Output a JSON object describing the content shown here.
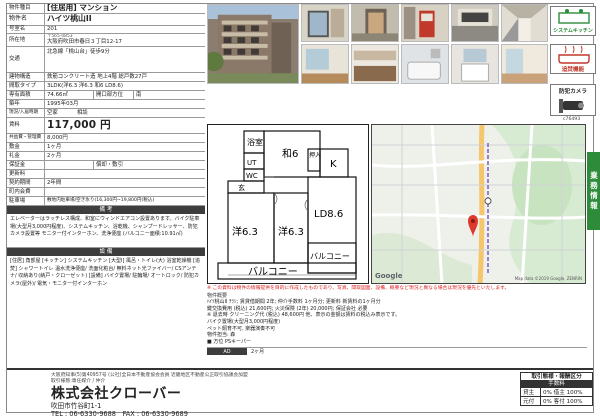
{
  "property": {
    "category_label": "物件種目",
    "category": "[住居用] マンション",
    "name_label": "物件名",
    "name": "ハイツ桃山II",
    "room_label": "号室名",
    "room": "201",
    "address_label": "所在地",
    "postal": "〒565-0853",
    "address": "大阪府吹田市春日３丁目12-17",
    "transport_label": "交通",
    "transport": "北急線「桃山台」徒歩9分",
    "structure_label": "建物構造",
    "structure": "鉄筋コンクリート造 地上4階 総戸数27戸",
    "layout_label": "間取タイプ",
    "layout": "3LDK(洋6.3 洋6.3 和6 LD8.6)",
    "area_label": "専有面積",
    "area": "74.66㎡",
    "direction_label": "開口部方位",
    "direction": "南",
    "built_label": "築年",
    "built": "1995年03月",
    "status_label": "現況/入居時期",
    "status_a": "空家",
    "status_b": "相談",
    "rent_label": "賃料",
    "rent": "117,000 円",
    "fee_label": "共益費・管理費",
    "fee": "8,000円",
    "deposit_label": "敷金",
    "deposit": "1ヶ月",
    "key_label": "礼金",
    "key": "2ヶ月",
    "guarantee_label": "保証金",
    "guarantee_a": "償却・敷引",
    "renewal_label": "更新料",
    "term_label": "契約期間",
    "term": "2年間",
    "assoc_label": "町内会費",
    "parking_label": "駐車場",
    "parking": "敷地内駐車場/空き氷り(16,300円~19,800円(税込)"
  },
  "remarks": {
    "header": "備 考",
    "text": "エレベーターはラッチレス構成、和室にウィンドエアコン設置あります。バイク駐車場(大型月3,000円程度)、システムキッチン、浴乾機、シャンプードレッサー、防犯カメラ設置等 モニター付インターホン、洗浄便座 (バルコニー面積:10.91㎡)"
  },
  "equipment": {
    "header": "設 備",
    "text": "[住居] 角部屋 [キッチン] システムキッチン [大型I] 風呂・トイレ(大) 浴室乾燥機 [追焚] シャワートイレ 温水洗浄便座/ 洗面化粧台/ 無料ネット光ファイバー/ CSアンテナ/ 収納あり(納戸・クローゼット) [設備] バイク置場/ 駐輪場/ オートロック/ 防犯カメラ(屋外)/ 電気・モニター付インターホン"
  },
  "badges": {
    "system_kitchen": "システムキッチン",
    "shower_toilet": "追焚機能",
    "security_camera": "防犯カメラ",
    "code": "c76493"
  },
  "side_tab": [
    "業",
    "務",
    "情",
    "報"
  ],
  "plan": {
    "bath": "浴室",
    "ut": "UT",
    "wa": "和6",
    "k": "K",
    "wc": "WC",
    "shu": "押入",
    "hall": "玄",
    "ld": "LD8.6",
    "west": "洋6.3",
    "east": "洋6.3",
    "balcony": "バルコニー",
    "balcony2": "バルコニー"
  },
  "map": {
    "google": "Google",
    "copyright": "Map data ©2019 Google, ZENRIN"
  },
  "notice": {
    "red": "※ この資料は物件の情報提供を目的に作成したものであり、写真、間取図面、設備、概要など現況と異なる場合は現況を優先といたします。",
    "caption": "物件概要",
    "lines": [
      "ﾊｲﾂ桃山II ﾁﾗｼ; 賃貸借期間 2年; 仲介手数料 1ヶ月分; 更新料 新賃料の1ヶ月分",
      "鍵交換費用 (税込) 21,600円; 火災保険 (2年) 20,000円; 保証会社 必要",
      "※ 退去時 クリーニング代 (税込) 48,600円 他、表示の金額は賃料の税込み表示です。",
      "バイク置場(大型月3,000円程度)",
      "ペット飼育不可, 楽器演奏不可",
      "物件担当: 森",
      "■ 方位 PSキーパー"
    ],
    "ad_label": "AD",
    "ad_value": "2ヶ月"
  },
  "company": {
    "address_line": "大阪府知事(5)第40957号 (公社)全日本不動産協会会員 近畿地区不動産公正取引協議会加盟",
    "license_line": "取引様態:専任媒介 / 仲介",
    "name": "株式会社クローバー",
    "street": "吹田市竹谷町1-1",
    "tel": "TEL : 06-6330-9688　FAX : 06-6330-9689"
  },
  "fees": {
    "title": "取引態様・報酬区分",
    "head": "手数料",
    "row1_k": "貸主",
    "row1_v": "0% 借主 100%",
    "row2_k": "元付",
    "row2_v": "0% 客付 100%"
  },
  "colors": {
    "band": "#3d3d3d",
    "vtab": "#2e8b3a",
    "red": "#d22222",
    "pin": "#db3a2c"
  }
}
